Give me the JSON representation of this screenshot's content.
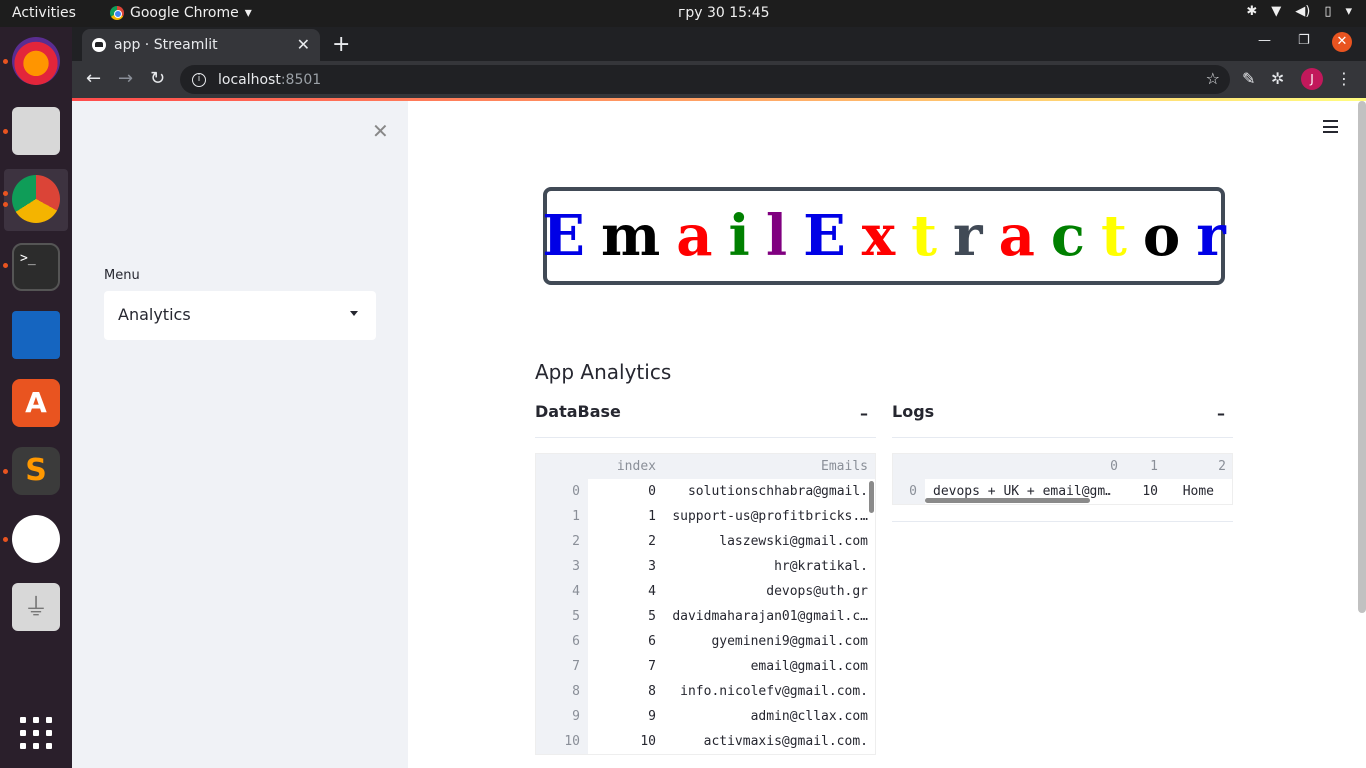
{
  "system": {
    "activities": "Activities",
    "app_menu": "Google Chrome",
    "clock": "гру 30  15:45"
  },
  "browser": {
    "tab_title": "app · Streamlit",
    "url_host": "localhost",
    "url_port": ":8501",
    "profile_initial": "J"
  },
  "sidebar": {
    "menu_label": "Menu",
    "selected": "Analytics"
  },
  "banner": {
    "letters": [
      {
        "ch": "E",
        "color": "#0000e6"
      },
      {
        "ch": "m",
        "color": "#000000"
      },
      {
        "ch": "a",
        "color": "#ff0000"
      },
      {
        "ch": "i",
        "color": "#008000"
      },
      {
        "ch": "l",
        "color": "#800080"
      },
      {
        "ch": "E",
        "color": "#0000e6"
      },
      {
        "ch": "x",
        "color": "#ff0000"
      },
      {
        "ch": "t",
        "color": "#ffff00"
      },
      {
        "ch": "r",
        "color": "#414a56"
      },
      {
        "ch": "a",
        "color": "#ff0000"
      },
      {
        "ch": "c",
        "color": "#008000"
      },
      {
        "ch": "t",
        "color": "#ffff00"
      },
      {
        "ch": "o",
        "color": "#000000"
      },
      {
        "ch": "r",
        "color": "#0000e6"
      }
    ]
  },
  "main": {
    "heading": "App Analytics",
    "database": {
      "title": "DataBase",
      "toggle": "–",
      "columns": [
        "index",
        "Emails"
      ],
      "rows": [
        {
          "idx": "0",
          "index": "0",
          "email": "solutionschhabra@gmail."
        },
        {
          "idx": "1",
          "index": "1",
          "email": "support-us@profitbricks.…"
        },
        {
          "idx": "2",
          "index": "2",
          "email": "laszewski@gmail.com"
        },
        {
          "idx": "3",
          "index": "3",
          "email": "hr@kratikal."
        },
        {
          "idx": "4",
          "index": "4",
          "email": "devops@uth.gr"
        },
        {
          "idx": "5",
          "index": "5",
          "email": "davidmaharajan01@gmail.c…"
        },
        {
          "idx": "6",
          "index": "6",
          "email": "gyemineni9@gmail.com"
        },
        {
          "idx": "7",
          "index": "7",
          "email": "email@gmail.com"
        },
        {
          "idx": "8",
          "index": "8",
          "email": "info.nicolefv@gmail.com."
        },
        {
          "idx": "9",
          "index": "9",
          "email": "admin@cllax.com"
        },
        {
          "idx": "10",
          "index": "10",
          "email": "activmaxis@gmail.com."
        }
      ]
    },
    "logs": {
      "title": "Logs",
      "toggle": "–",
      "columns": [
        "0",
        "1",
        "2"
      ],
      "rows": [
        {
          "idx": "0",
          "c0": "devops + UK + email@gm…",
          "c1": "10",
          "c2": "Home"
        }
      ]
    }
  }
}
